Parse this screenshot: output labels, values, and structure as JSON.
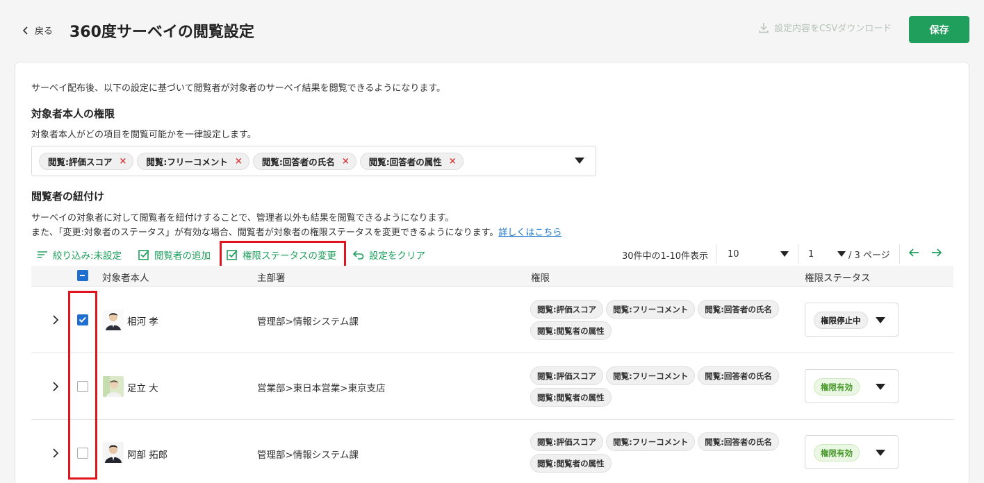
{
  "header": {
    "back_label": "戻る",
    "title": "360度サーベイの閲覧設定",
    "csv_label": "設定内容をCSVダウンロード",
    "save_label": "保存"
  },
  "intro": "サーベイ配布後、以下の設定に基づいて閲覧者が対象者のサーベイ結果を閲覧できるようになります。",
  "self_section": {
    "title": "対象者本人の権限",
    "description": "対象者本人がどの項目を閲覧可能かを一律設定します。",
    "chips": [
      "閲覧:評価スコア",
      "閲覧:フリーコメント",
      "閲覧:回答者の氏名",
      "閲覧:回答者の属性"
    ],
    "remove_glyph": "×"
  },
  "viewer_section": {
    "title": "閲覧者の紐付け",
    "description_1": "サーベイの対象者に対して閲覧者を紐付けすることで、管理者以外も結果を閲覧できるようになります。",
    "description_2": "また、「変更:対象者のステータス」が有効な場合、閲覧者が対象者の権限ステータスを変更できるようになります。",
    "link_label": "詳しくはこちら"
  },
  "toolbar": {
    "filter_label": "絞り込み:未設定",
    "add_viewer_label": "閲覧者の追加",
    "change_status_label": "権限ステータスの変更",
    "clear_label": "設定をクリア",
    "count_text": "30件中の1-10件表示",
    "per_page": "10",
    "page": "1",
    "page_total": "/ 3 ページ"
  },
  "table": {
    "headers": [
      "対象者本人",
      "主部署",
      "権限",
      "権限ステータス"
    ],
    "rows": [
      {
        "name": "相河 孝",
        "dept": "管理部>情報システム課",
        "checked": true,
        "perms": [
          "閲覧:評価スコア",
          "閲覧:フリーコメント",
          "閲覧:回答者の氏名",
          "閲覧:閲覧者の属性"
        ],
        "status": "権限停止中",
        "status_type": "stop"
      },
      {
        "name": "足立 大",
        "dept": "営業部>東日本営業>東京支店",
        "checked": false,
        "perms": [
          "閲覧:評価スコア",
          "閲覧:フリーコメント",
          "閲覧:回答者の氏名",
          "閲覧:閲覧者の属性"
        ],
        "status": "権限有効",
        "status_type": "active"
      },
      {
        "name": "阿部 拓郎",
        "dept": "管理部>情報システム課",
        "checked": false,
        "perms": [
          "閲覧:評価スコア",
          "閲覧:フリーコメント",
          "閲覧:回答者の氏名",
          "閲覧:閲覧者の属性"
        ],
        "status": "権限有効",
        "status_type": "active"
      }
    ]
  },
  "colors": {
    "accent_green": "#1f9e5c",
    "highlight_red": "#e0141e",
    "checkbox_blue": "#1f6fd0"
  }
}
